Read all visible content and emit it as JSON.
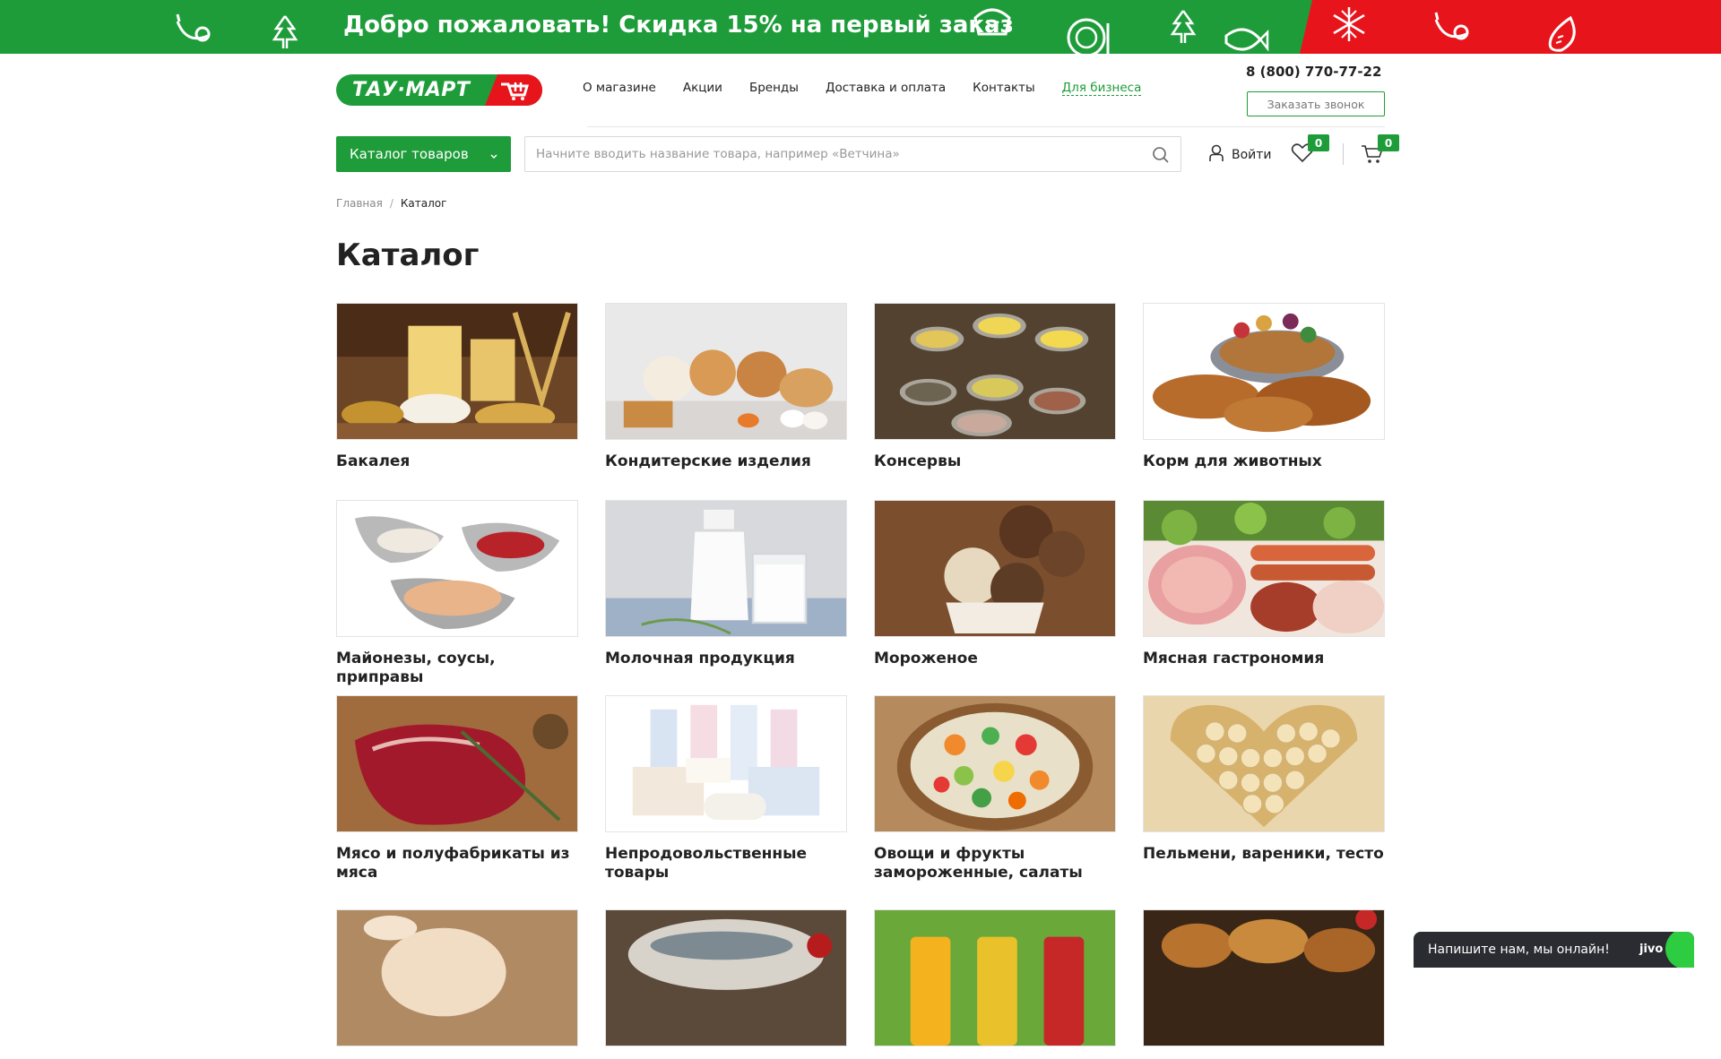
{
  "promo": {
    "text": "Добро пожаловать! Скидка 15% на первый заказ",
    "icons": [
      "banana-icon",
      "tree-icon",
      "bread-icon",
      "plate-icon",
      "tree-icon",
      "fish-icon",
      "snowflake-icon",
      "banana-icon",
      "pear-icon"
    ],
    "colors": {
      "green": "#1e9c3a",
      "red": "#e8141b"
    }
  },
  "header": {
    "logo_text": "ТАУ·МАРТ",
    "nav": [
      "О магазине",
      "Акции",
      "Бренды",
      "Доставка и оплата",
      "Контакты",
      "Для бизнеса"
    ],
    "phone": "8 (800) 770-77-22",
    "callback_label": "Заказать звонок",
    "catalog_button": "Каталог товаров",
    "search_placeholder": "Начните вводить название товара, например «Ветчина»",
    "login_label": "Войти",
    "favorites_count": "0",
    "cart_count": "0"
  },
  "breadcrumb": {
    "home": "Главная",
    "separator": "/",
    "current": "Каталог"
  },
  "page_title": "Каталог",
  "categories": [
    {
      "name": "Бакалея",
      "image": "pasta-grains-photo"
    },
    {
      "name": "Кондитерские изделия",
      "image": "pastries-photo"
    },
    {
      "name": "Консервы",
      "image": "canned-food-photo"
    },
    {
      "name": "Корм для животных",
      "image": "pet-food-photo"
    },
    {
      "name": "Майонезы, соусы, приправы",
      "image": "sauces-photo"
    },
    {
      "name": "Молочная продукция",
      "image": "milk-photo"
    },
    {
      "name": "Мороженое",
      "image": "ice-cream-photo"
    },
    {
      "name": "Мясная гастрономия",
      "image": "sausages-photo"
    },
    {
      "name": "Мясо и полуфабрикаты из мяса",
      "image": "raw-meat-photo"
    },
    {
      "name": "Непродовольственные товары",
      "image": "paper-towels-photo"
    },
    {
      "name": "Овощи и фрукты замороженные, салаты",
      "image": "frozen-vegetables-photo"
    },
    {
      "name": "Пельмени, вареники, тесто",
      "image": "dumplings-photo"
    },
    {
      "name": "",
      "image": "chicken-photo"
    },
    {
      "name": "",
      "image": "fish-photo"
    },
    {
      "name": "",
      "image": "juices-photo"
    },
    {
      "name": "",
      "image": "bread-photo"
    }
  ],
  "chat": {
    "text": "Напишите нам, мы онлайн!",
    "logo": "jivo"
  }
}
